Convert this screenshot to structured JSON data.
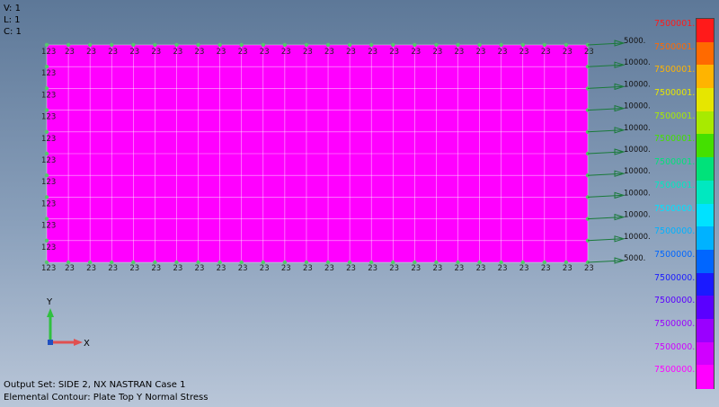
{
  "view_info": {
    "v": "V: 1",
    "l": "L: 1",
    "c": "C: 1"
  },
  "footer": {
    "output_set": "Output Set: SIDE 2, NX NASTRAN Case 1",
    "contour": "Elemental Contour: Plate Top Y Normal Stress"
  },
  "axes": {
    "y_label": "Y",
    "x_label": "X"
  },
  "colors": {
    "plate_fill": "#ff00ff",
    "mesh_line": "#ffffff",
    "node_color": "#55c76b",
    "load_arrow": "#1a7a3a",
    "constraint_text": "#222222"
  },
  "mesh": {
    "columns": 25,
    "rows": 10,
    "constraint_label": "123",
    "constraint_label_short": "23"
  },
  "loads": [
    "5000.",
    "10000.",
    "10000.",
    "10000.",
    "10000.",
    "10000.",
    "10000.",
    "10000.",
    "10000.",
    "10000.",
    "5000."
  ],
  "legend": [
    {
      "label": "7500001.",
      "color": "#ff1a1a"
    },
    {
      "label": "7500001.",
      "color": "#ff6a00"
    },
    {
      "label": "7500001.",
      "color": "#ffb400"
    },
    {
      "label": "7500001.",
      "color": "#e6e600"
    },
    {
      "label": "7500001.",
      "color": "#a8ea00"
    },
    {
      "label": "7500001.",
      "color": "#44e000"
    },
    {
      "label": "7500001.",
      "color": "#00e27a"
    },
    {
      "label": "7500001.",
      "color": "#00e8c0"
    },
    {
      "label": "7500000.",
      "color": "#00e2ff"
    },
    {
      "label": "7500000.",
      "color": "#00b2ff"
    },
    {
      "label": "7500000.",
      "color": "#0066ff"
    },
    {
      "label": "7500000.",
      "color": "#1a1aff"
    },
    {
      "label": "7500000.",
      "color": "#5a00ff"
    },
    {
      "label": "7500000.",
      "color": "#9a00ff"
    },
    {
      "label": "7500000.",
      "color": "#d000ff"
    },
    {
      "label": "7500000.",
      "color": "#ff00ff"
    }
  ]
}
